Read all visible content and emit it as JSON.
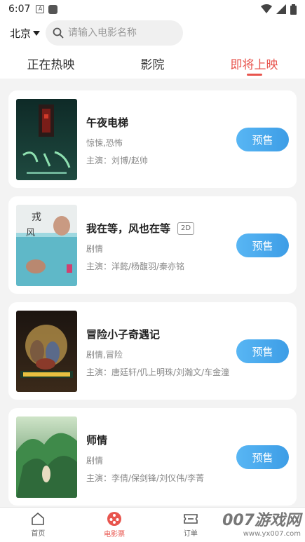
{
  "status_bar": {
    "time": "6:07"
  },
  "header": {
    "city": "北京",
    "search_placeholder": "请输入电影名称"
  },
  "tabs": [
    {
      "label": "正在热映",
      "active": false
    },
    {
      "label": "影院",
      "active": false
    },
    {
      "label": "即将上映",
      "active": true
    }
  ],
  "movies": [
    {
      "title": "午夜电梯",
      "genre": "惊悚,恐怖",
      "cast": "主演：刘博/赵帅",
      "tag": "",
      "button": "预售"
    },
    {
      "title": "我在等，风也在等",
      "genre": "剧情",
      "cast": "主演：洋懿/杨馥羽/秦亦铭",
      "tag": "2D",
      "button": "预售"
    },
    {
      "title": "冒险小子奇遇记",
      "genre": "剧情,冒险",
      "cast": "主演：唐廷轩/仉上明珠/刘瀚文/车金潼",
      "tag": "",
      "button": "预售"
    },
    {
      "title": "师情",
      "genre": "剧情",
      "cast": "主演：李倩/保剑锋/刘仪伟/李菁",
      "tag": "",
      "button": "预售"
    }
  ],
  "bottom_nav": [
    {
      "label": "首页",
      "icon": "home-icon"
    },
    {
      "label": "电影票",
      "icon": "film-reel-icon",
      "active": true
    },
    {
      "label": "订单",
      "icon": "ticket-icon"
    }
  ],
  "watermark": {
    "line1": "007游戏网",
    "line2": "www.yx007.com"
  },
  "colors": {
    "accent": "#e8554e",
    "button": "#4aa8ee"
  }
}
